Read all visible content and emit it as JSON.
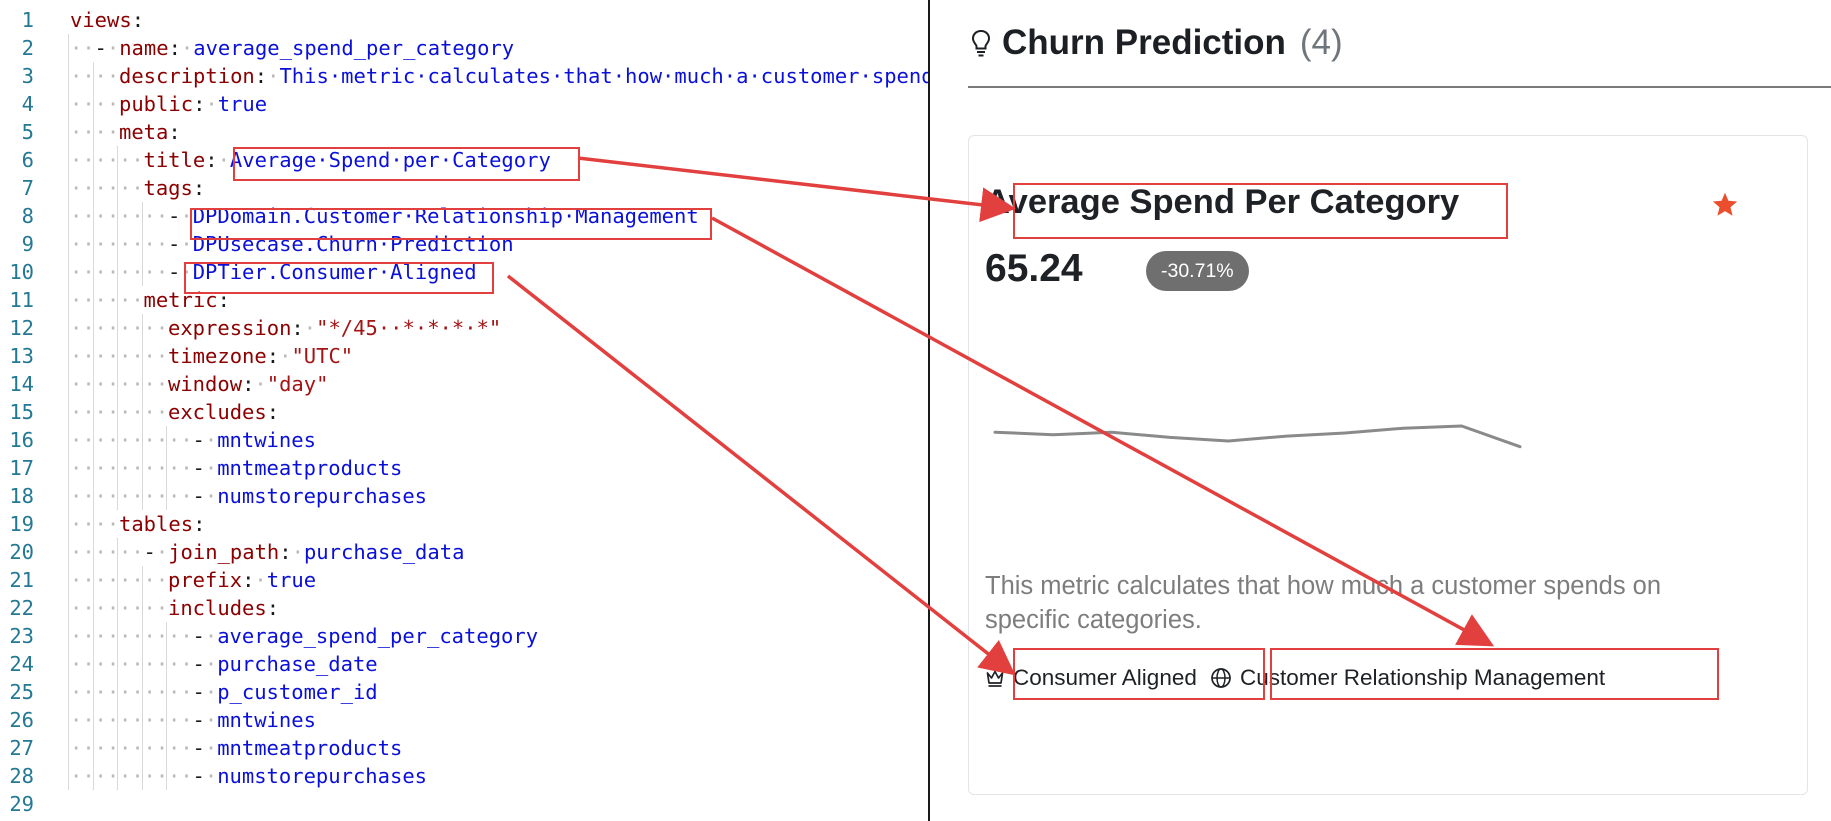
{
  "editor": {
    "lines": [
      {
        "n": "1",
        "indent": 0,
        "tokens": [
          {
            "c": "k",
            "t": "views"
          },
          {
            "c": "p",
            "t": ":"
          }
        ]
      },
      {
        "n": "2",
        "indent": 1,
        "tokens": [
          {
            "c": "p",
            "t": "-"
          },
          {
            "c": "d",
            "t": "·"
          },
          {
            "c": "k",
            "t": "name"
          },
          {
            "c": "p",
            "t": ":"
          },
          {
            "c": "d",
            "t": "·"
          },
          {
            "c": "v",
            "t": "average_spend_per_category"
          }
        ]
      },
      {
        "n": "3",
        "indent": 2,
        "tokens": [
          {
            "c": "k",
            "t": "description"
          },
          {
            "c": "p",
            "t": ":"
          },
          {
            "c": "d",
            "t": "·"
          },
          {
            "c": "v",
            "t": "This·metric·calculates·that·how·much·a·customer·spends·on·specific·categories."
          }
        ]
      },
      {
        "n": "4",
        "indent": 2,
        "tokens": [
          {
            "c": "k",
            "t": "public"
          },
          {
            "c": "p",
            "t": ":"
          },
          {
            "c": "d",
            "t": "·"
          },
          {
            "c": "v",
            "t": "true"
          }
        ]
      },
      {
        "n": "5",
        "indent": 2,
        "tokens": [
          {
            "c": "k",
            "t": "meta"
          },
          {
            "c": "p",
            "t": ":"
          }
        ]
      },
      {
        "n": "6",
        "indent": 3,
        "tokens": [
          {
            "c": "k",
            "t": "title"
          },
          {
            "c": "p",
            "t": ":"
          },
          {
            "c": "d",
            "t": "·"
          },
          {
            "c": "v",
            "t": "Average·Spend·per·Category"
          }
        ]
      },
      {
        "n": "7",
        "indent": 3,
        "tokens": [
          {
            "c": "k",
            "t": "tags"
          },
          {
            "c": "p",
            "t": ":"
          }
        ]
      },
      {
        "n": "8",
        "indent": 4,
        "tokens": [
          {
            "c": "p",
            "t": "-"
          },
          {
            "c": "d",
            "t": "·"
          },
          {
            "c": "v",
            "t": "DPDomain.Customer·Relationship·Management"
          }
        ]
      },
      {
        "n": "9",
        "indent": 4,
        "tokens": [
          {
            "c": "p",
            "t": "-"
          },
          {
            "c": "d",
            "t": "·"
          },
          {
            "c": "v",
            "t": "DPUsecase.Churn·Prediction"
          }
        ]
      },
      {
        "n": "10",
        "indent": 4,
        "tokens": [
          {
            "c": "p",
            "t": "-"
          },
          {
            "c": "d",
            "t": "·"
          },
          {
            "c": "v",
            "t": "DPTier.Consumer·Aligned"
          }
        ]
      },
      {
        "n": "11",
        "indent": 3,
        "tokens": [
          {
            "c": "k",
            "t": "metric"
          },
          {
            "c": "p",
            "t": ":"
          }
        ]
      },
      {
        "n": "12",
        "indent": 4,
        "tokens": [
          {
            "c": "k",
            "t": "expression"
          },
          {
            "c": "p",
            "t": ":"
          },
          {
            "c": "d",
            "t": "·"
          },
          {
            "c": "s",
            "t": "\"*/45··*·*·*·*\""
          }
        ]
      },
      {
        "n": "13",
        "indent": 4,
        "tokens": [
          {
            "c": "k",
            "t": "timezone"
          },
          {
            "c": "p",
            "t": ":"
          },
          {
            "c": "d",
            "t": "·"
          },
          {
            "c": "s",
            "t": "\"UTC\""
          }
        ]
      },
      {
        "n": "14",
        "indent": 4,
        "tokens": [
          {
            "c": "k",
            "t": "window"
          },
          {
            "c": "p",
            "t": ":"
          },
          {
            "c": "d",
            "t": "·"
          },
          {
            "c": "s",
            "t": "\"day\""
          }
        ]
      },
      {
        "n": "15",
        "indent": 4,
        "tokens": [
          {
            "c": "k",
            "t": "excludes"
          },
          {
            "c": "p",
            "t": ":"
          }
        ]
      },
      {
        "n": "16",
        "indent": 5,
        "tokens": [
          {
            "c": "p",
            "t": "-"
          },
          {
            "c": "d",
            "t": "·"
          },
          {
            "c": "v",
            "t": "mntwines"
          }
        ]
      },
      {
        "n": "17",
        "indent": 5,
        "tokens": [
          {
            "c": "p",
            "t": "-"
          },
          {
            "c": "d",
            "t": "·"
          },
          {
            "c": "v",
            "t": "mntmeatproducts"
          }
        ]
      },
      {
        "n": "18",
        "indent": 5,
        "tokens": [
          {
            "c": "p",
            "t": "-"
          },
          {
            "c": "d",
            "t": "·"
          },
          {
            "c": "v",
            "t": "numstorepurchases"
          }
        ]
      },
      {
        "n": "19",
        "indent": 2,
        "tokens": [
          {
            "c": "k",
            "t": "tables"
          },
          {
            "c": "p",
            "t": ":"
          }
        ]
      },
      {
        "n": "20",
        "indent": 3,
        "tokens": [
          {
            "c": "p",
            "t": "-"
          },
          {
            "c": "d",
            "t": "·"
          },
          {
            "c": "k",
            "t": "join_path"
          },
          {
            "c": "p",
            "t": ":"
          },
          {
            "c": "d",
            "t": "·"
          },
          {
            "c": "v",
            "t": "purchase_data"
          }
        ]
      },
      {
        "n": "21",
        "indent": 4,
        "tokens": [
          {
            "c": "k",
            "t": "prefix"
          },
          {
            "c": "p",
            "t": ":"
          },
          {
            "c": "d",
            "t": "·"
          },
          {
            "c": "v",
            "t": "true"
          }
        ]
      },
      {
        "n": "22",
        "indent": 4,
        "tokens": [
          {
            "c": "k",
            "t": "includes"
          },
          {
            "c": "p",
            "t": ":"
          }
        ]
      },
      {
        "n": "23",
        "indent": 5,
        "tokens": [
          {
            "c": "p",
            "t": "-"
          },
          {
            "c": "d",
            "t": "·"
          },
          {
            "c": "v",
            "t": "average_spend_per_category"
          }
        ]
      },
      {
        "n": "24",
        "indent": 5,
        "tokens": [
          {
            "c": "p",
            "t": "-"
          },
          {
            "c": "d",
            "t": "·"
          },
          {
            "c": "v",
            "t": "purchase_date"
          }
        ]
      },
      {
        "n": "25",
        "indent": 5,
        "tokens": [
          {
            "c": "p",
            "t": "-"
          },
          {
            "c": "d",
            "t": "·"
          },
          {
            "c": "v",
            "t": "p_customer_id"
          }
        ]
      },
      {
        "n": "26",
        "indent": 5,
        "tokens": [
          {
            "c": "p",
            "t": "-"
          },
          {
            "c": "d",
            "t": "·"
          },
          {
            "c": "v",
            "t": "mntwines"
          }
        ]
      },
      {
        "n": "27",
        "indent": 5,
        "tokens": [
          {
            "c": "p",
            "t": "-"
          },
          {
            "c": "d",
            "t": "·"
          },
          {
            "c": "v",
            "t": "mntmeatproducts"
          }
        ]
      },
      {
        "n": "28",
        "indent": 5,
        "tokens": [
          {
            "c": "p",
            "t": "-"
          },
          {
            "c": "d",
            "t": "·"
          },
          {
            "c": "v",
            "t": "numstorepurchases"
          }
        ]
      },
      {
        "n": "29",
        "indent": 0,
        "tokens": []
      }
    ],
    "colors": {
      "key": "#8b0000",
      "value": "#0a10d8",
      "string": "#a31515",
      "line_number": "#237893"
    }
  },
  "panel": {
    "title": "Churn Prediction",
    "count": "(4)",
    "icon": "lightbulb-icon"
  },
  "metric": {
    "title": "Average Spend Per Category",
    "value": "65.24",
    "change": "-30.71%",
    "favorite_icon": "star-icon",
    "favorite_color": "#ea4e2c",
    "description": "This metric calculates that how much a customer spends on specific categories.",
    "trend": [
      0.86,
      0.8,
      0.86,
      0.74,
      0.66,
      0.77,
      0.84,
      0.95,
      1.0,
      0.53
    ],
    "tags": [
      {
        "label": "Consumer Aligned",
        "icon": "crown-icon"
      },
      {
        "label": "Customer Relationship Management",
        "icon": "globe-icon"
      }
    ]
  },
  "annotation_color": "#e2403e"
}
